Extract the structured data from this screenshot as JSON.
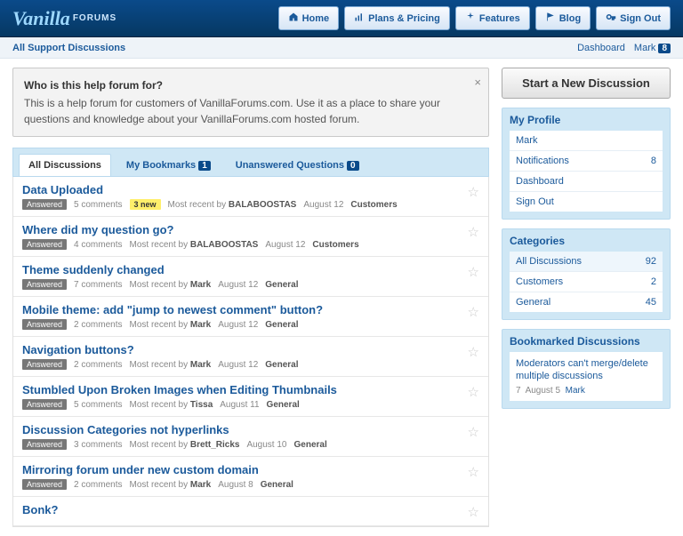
{
  "header": {
    "logo_script": "Vanilla",
    "logo_word": "FORUMS",
    "nav": [
      {
        "label": "Home",
        "icon": "home"
      },
      {
        "label": "Plans & Pricing",
        "icon": "bars"
      },
      {
        "label": "Features",
        "icon": "sparkle"
      },
      {
        "label": "Blog",
        "icon": "flag"
      },
      {
        "label": "Sign Out",
        "icon": "key"
      }
    ]
  },
  "subbar": {
    "title": "All Support Discussions",
    "dashboard": "Dashboard",
    "user": "Mark",
    "user_count": "8"
  },
  "notice": {
    "heading": "Who is this help forum for?",
    "body": "This is a help forum for customers of VanillaForums.com. Use it as a place to share your questions and knowledge about your VanillaForums.com hosted forum."
  },
  "tabs": [
    {
      "label": "All Discussions",
      "count": null,
      "active": true
    },
    {
      "label": "My Bookmarks",
      "count": "1",
      "active": false
    },
    {
      "label": "Unanswered Questions",
      "count": "0",
      "active": false
    }
  ],
  "discussions": [
    {
      "title": "Data Uploaded",
      "answered": true,
      "comments": "5 comments",
      "new": "3 new",
      "recent": "Most recent by",
      "author": "BALABOOSTAS",
      "date": "August 12",
      "category": "Customers"
    },
    {
      "title": "Where did my question go?",
      "answered": true,
      "comments": "4 comments",
      "new": null,
      "recent": "Most recent by",
      "author": "BALABOOSTAS",
      "date": "August 12",
      "category": "Customers"
    },
    {
      "title": "Theme suddenly changed",
      "answered": true,
      "comments": "7 comments",
      "new": null,
      "recent": "Most recent by",
      "author": "Mark",
      "date": "August 12",
      "category": "General"
    },
    {
      "title": "Mobile theme: add \"jump to newest comment\" button?",
      "answered": true,
      "comments": "2 comments",
      "new": null,
      "recent": "Most recent by",
      "author": "Mark",
      "date": "August 12",
      "category": "General"
    },
    {
      "title": "Navigation buttons?",
      "answered": true,
      "comments": "2 comments",
      "new": null,
      "recent": "Most recent by",
      "author": "Mark",
      "date": "August 12",
      "category": "General"
    },
    {
      "title": "Stumbled Upon Broken Images when Editing Thumbnails",
      "answered": true,
      "comments": "5 comments",
      "new": null,
      "recent": "Most recent by",
      "author": "Tissa",
      "date": "August 11",
      "category": "General"
    },
    {
      "title": "Discussion Categories not hyperlinks",
      "answered": true,
      "comments": "3 comments",
      "new": null,
      "recent": "Most recent by",
      "author": "Brett_Ricks",
      "date": "August 10",
      "category": "General"
    },
    {
      "title": "Mirroring forum under new custom domain",
      "answered": true,
      "comments": "2 comments",
      "new": null,
      "recent": "Most recent by",
      "author": "Mark",
      "date": "August 8",
      "category": "General"
    },
    {
      "title": "Bonk?",
      "answered": false,
      "comments": "",
      "new": null,
      "recent": "",
      "author": "",
      "date": "",
      "category": ""
    }
  ],
  "sidebar": {
    "new_discussion": "Start a New Discussion",
    "profile": {
      "heading": "My Profile",
      "items": [
        {
          "label": "Mark",
          "count": null
        },
        {
          "label": "Notifications",
          "count": "8"
        },
        {
          "label": "Dashboard",
          "count": null
        },
        {
          "label": "Sign Out",
          "count": null
        }
      ]
    },
    "categories": {
      "heading": "Categories",
      "items": [
        {
          "label": "All Discussions",
          "count": "92",
          "active": true
        },
        {
          "label": "Customers",
          "count": "2",
          "active": false
        },
        {
          "label": "General",
          "count": "45",
          "active": false
        }
      ]
    },
    "bookmarks": {
      "heading": "Bookmarked Discussions",
      "title": "Moderators can't merge/delete multiple discussions",
      "count": "7",
      "date": "August 5",
      "author": "Mark"
    }
  },
  "labels": {
    "answered": "Answered"
  }
}
